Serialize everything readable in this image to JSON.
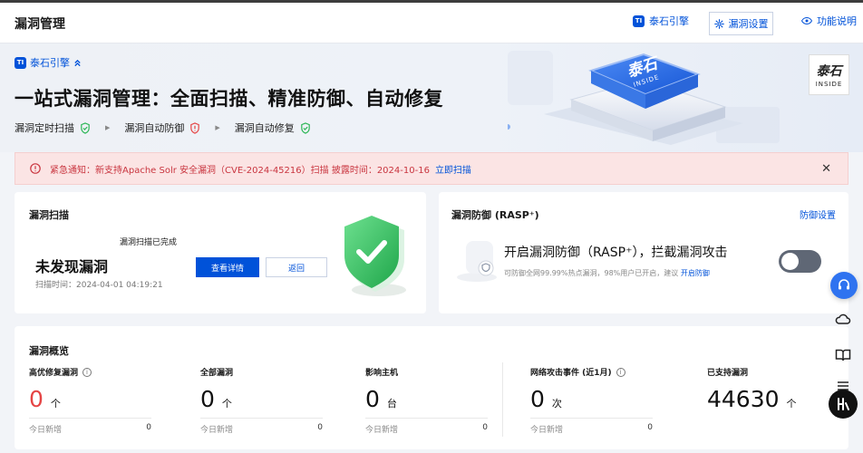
{
  "header": {
    "title": "漏洞管理",
    "engine_link": "泰石引擎",
    "settings_button": "漏洞设置",
    "help_link": "功能说明"
  },
  "hero": {
    "brand": "泰石引擎",
    "brand_badge": "TI",
    "title": "一站式漏洞管理：全面扫描、精准防御、自动修复",
    "steps": [
      "漏洞定时扫描",
      "漏洞自动防御",
      "漏洞自动修复"
    ],
    "logo_cn": "泰石",
    "logo_en": "INSIDE",
    "chip_text_cn": "泰石",
    "chip_text_en": "INSIDE"
  },
  "alert": {
    "text": "紧急通知：新支持Apache Solr 安全漏洞（CVE-2024-45216）扫描  披露时间：2024-10-16",
    "link": "立即扫描",
    "close": "✕"
  },
  "scan": {
    "title": "漏洞扫描",
    "done_label": "漏洞扫描已完成",
    "status": "未发现漏洞",
    "time": "扫描时间：2024-04-01 04:19:21",
    "details_button": "查看详情",
    "back_button": "返回"
  },
  "rasp": {
    "title": "漏洞防御 (RASP⁺)",
    "settings_link": "防御设置",
    "heading": "开启漏洞防御（RASP⁺），拦截漏洞攻击",
    "subtitle": "可防御全网99.99%热点漏洞，98%用户已开启，建议",
    "subtitle_link": "开启防御",
    "enabled": false
  },
  "overview": {
    "title": "漏洞概览",
    "stats": [
      {
        "label": "高优修复漏洞",
        "value": "0",
        "unit": "个",
        "foot_label": "今日新增",
        "foot_value": "0",
        "info": true,
        "red": true
      },
      {
        "label": "全部漏洞",
        "value": "0",
        "unit": "个",
        "foot_label": "今日新增",
        "foot_value": "0",
        "info": false,
        "red": false
      },
      {
        "label": "影响主机",
        "value": "0",
        "unit": "台",
        "foot_label": "今日新增",
        "foot_value": "0",
        "info": false,
        "red": false
      },
      {
        "label": "网络攻击事件 (近1月)",
        "value": "0",
        "unit": "次",
        "foot_label": "今日新增",
        "foot_value": "0",
        "info": true,
        "red": false
      },
      {
        "label": "已支持漏洞",
        "value": "44630",
        "unit": "个",
        "info": false,
        "red": false
      }
    ]
  },
  "colors": {
    "primary": "#0052d9",
    "danger": "#e54545",
    "alert_bg": "#fbe4e4",
    "shield_green": "#2bb655"
  }
}
